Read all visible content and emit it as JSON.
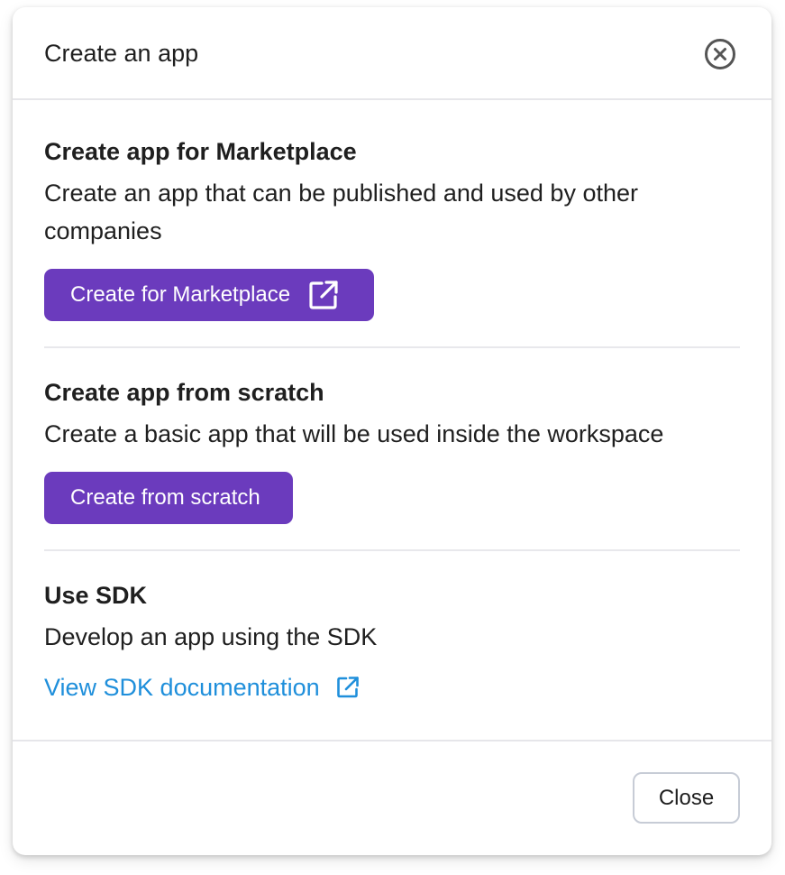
{
  "modal": {
    "title": "Create an app",
    "close_icon": "close-circle-icon"
  },
  "sections": [
    {
      "heading": "Create app for Marketplace",
      "description": "Create an app that can be published and used by other companies",
      "button_label": "Create for Marketplace",
      "button_icon": "external-link-icon"
    },
    {
      "heading": "Create app from scratch",
      "description": "Create a basic app that will be used inside the workspace",
      "button_label": "Create from scratch"
    },
    {
      "heading": "Use SDK",
      "description": "Develop an app using the SDK",
      "link_label": "View SDK documentation",
      "link_icon": "external-link-icon"
    }
  ],
  "footer": {
    "close_label": "Close"
  },
  "colors": {
    "primary": "#6b3bbd",
    "link": "#1f8fdb",
    "text": "#1f1f1f",
    "divider": "#e8e8ec"
  }
}
